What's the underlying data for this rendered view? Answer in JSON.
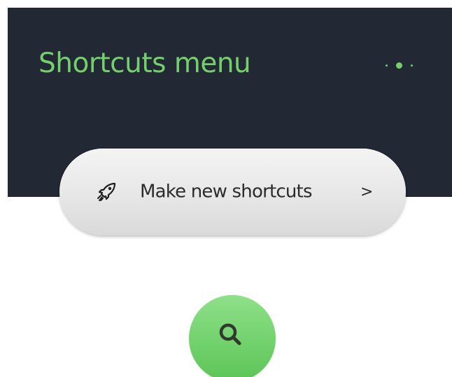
{
  "header": {
    "title": "Shortcuts menu",
    "accent_color": "#74d06c",
    "background_color": "#222834",
    "page_indicator": {
      "dots": 3,
      "active_index": 1
    }
  },
  "shortcut_button": {
    "label": "Make new shortcuts",
    "chevron": ">",
    "icon": "rocket-icon"
  },
  "search_button": {
    "icon": "search-icon",
    "color": "#72d26c"
  }
}
